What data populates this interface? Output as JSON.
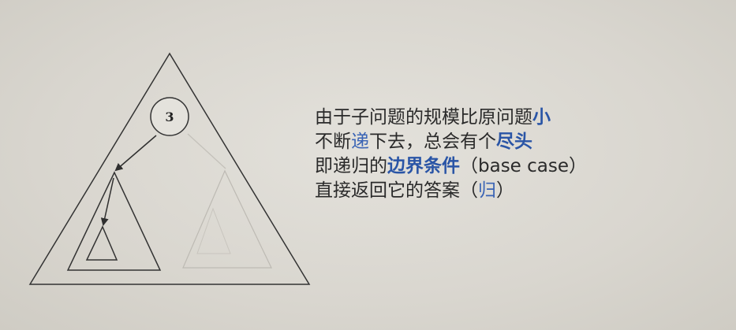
{
  "diagram": {
    "node_value": "3"
  },
  "explanation": {
    "line1": {
      "normal": "由于子问题的规模比原问题",
      "highlight": "小"
    },
    "line2": {
      "a": "不断",
      "highlight_light": "递",
      "b": "下去，总会有个",
      "highlight": "尽头"
    },
    "line3": {
      "a": "即递归的",
      "highlight": "边界条件",
      "b": "（base case）"
    },
    "line4": {
      "a": "直接返回它的答案（",
      "highlight_light": "归",
      "b": "）"
    }
  },
  "colors": {
    "background": "#dcd9d2",
    "text": "#2a2a2a",
    "highlight": "#2a55a6",
    "stroke": "#333333",
    "faded_stroke": "#b5b2ab"
  }
}
